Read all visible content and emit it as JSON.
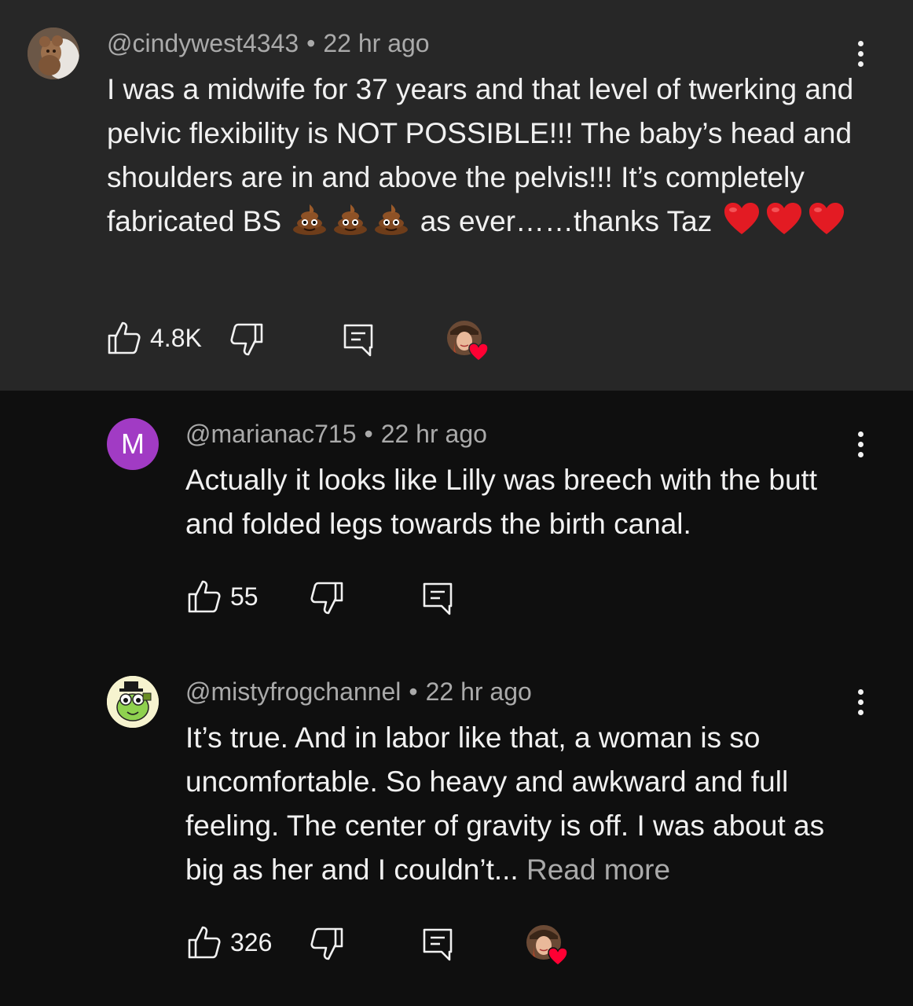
{
  "comments": [
    {
      "username": "@cindywest4343",
      "time": "22 hr ago",
      "text_before": "I was a midwife for 37 years and that level of twerking and pelvic flexibility is NOT POSSIBLE!!! The baby’s head and shoulders are in and above the pelvis!!! It’s completely fabricated BS",
      "text_mid": "as ever……thanks Taz",
      "likes": "4.8K",
      "creator_hearted": true,
      "avatar_icon": "teddy-bear-photo-icon"
    },
    {
      "username": "@marianac715",
      "time": "22 hr ago",
      "text": "Actually it looks like Lilly was breech with the butt and folded legs towards the birth canal.",
      "likes": "55",
      "avatar_letter": "M",
      "avatar_color": "#a13bc4",
      "creator_hearted": false
    },
    {
      "username": "@mistyfrogchannel",
      "time": "22 hr ago",
      "text": "It’s true. And in labor like that, a woman is so uncomfortable. So heavy and awkward and full feeling. The center of gravity is off. I was about as big as her and I couldn’t...",
      "read_more": "Read more",
      "likes": "326",
      "creator_hearted": true,
      "avatar_icon": "frog-cartoon-icon"
    }
  ],
  "colors": {
    "top_comment_bg": "#272727",
    "page_bg": "#0f0f0f",
    "text_primary": "#f1f1f1",
    "text_secondary": "#aaaaaa",
    "heart": "#ff0033"
  }
}
